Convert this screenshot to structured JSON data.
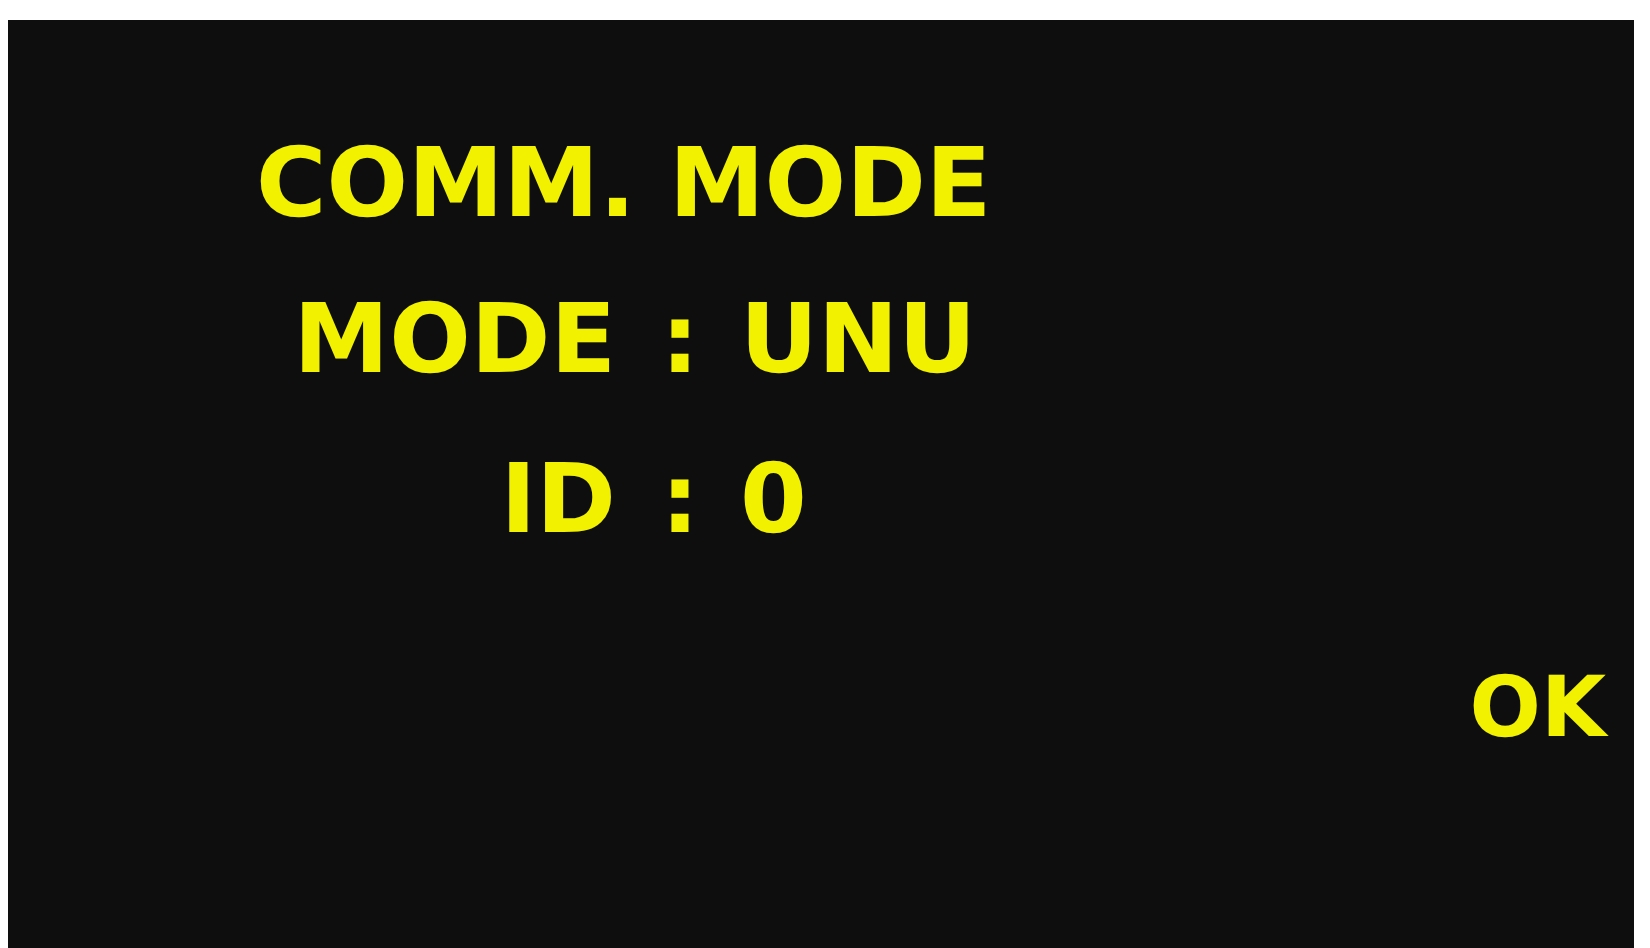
{
  "title": "COMM. MODE",
  "fields": [
    {
      "label": "MODE",
      "separator": ":",
      "value": "UNU"
    },
    {
      "label": "ID",
      "separator": ":",
      "value": "0"
    }
  ],
  "ok_button": "OK"
}
